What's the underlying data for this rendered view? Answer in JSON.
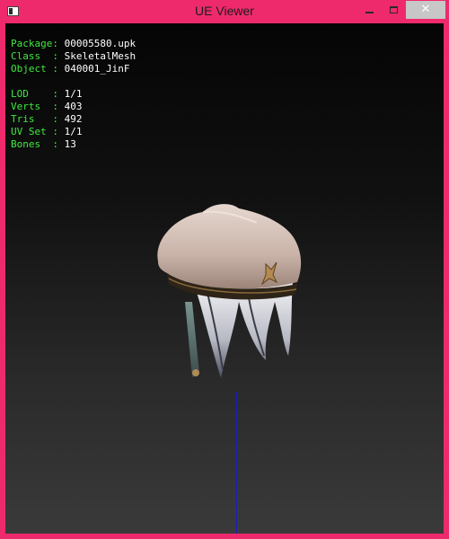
{
  "window": {
    "title": "UE Viewer",
    "minimize_glyph": "",
    "maximize_glyph": "",
    "close_glyph": "✕"
  },
  "colors": {
    "titlebar": "#ef2a6c",
    "key_text": "#3fe93f",
    "value_text": "#ffffff",
    "axis": "#1b1bbf"
  },
  "info": {
    "package_key": "Package:",
    "package_val": "00005580.upk",
    "class_key": "Class  :",
    "class_val": "SkeletalMesh",
    "object_key": "Object :",
    "object_val": "040001_JinF",
    "lod_key": "LOD    :",
    "lod_val": "1/1",
    "verts_key": "Verts  :",
    "verts_val": "403",
    "tris_key": "Tris   :",
    "tris_val": "492",
    "uvset_key": "UV Set :",
    "uvset_val": "1/1",
    "bones_key": "Bones  :",
    "bones_val": "13"
  },
  "icons": {
    "app": "app-icon",
    "minimize": "minimize-icon",
    "maximize": "maximize-icon",
    "close": "close-icon"
  }
}
